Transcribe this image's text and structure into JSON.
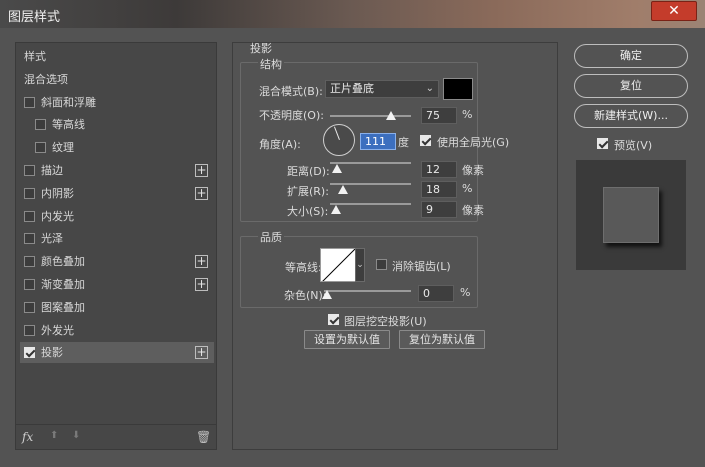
{
  "window": {
    "title": "图层样式",
    "close_label": "✕"
  },
  "left_panel": {
    "items": [
      {
        "label": "样式",
        "checkbox": false,
        "checked": false,
        "plus": false,
        "indent": 0
      },
      {
        "label": "混合选项",
        "checkbox": false,
        "checked": false,
        "plus": false,
        "indent": 0
      },
      {
        "label": "斜面和浮雕",
        "checkbox": true,
        "checked": false,
        "plus": false,
        "indent": 0
      },
      {
        "label": "等高线",
        "checkbox": true,
        "checked": false,
        "plus": false,
        "indent": 1
      },
      {
        "label": "纹理",
        "checkbox": true,
        "checked": false,
        "plus": false,
        "indent": 1
      },
      {
        "label": "描边",
        "checkbox": true,
        "checked": false,
        "plus": true,
        "indent": 0
      },
      {
        "label": "内阴影",
        "checkbox": true,
        "checked": false,
        "plus": true,
        "indent": 0
      },
      {
        "label": "内发光",
        "checkbox": true,
        "checked": false,
        "plus": false,
        "indent": 0
      },
      {
        "label": "光泽",
        "checkbox": true,
        "checked": false,
        "plus": false,
        "indent": 0
      },
      {
        "label": "颜色叠加",
        "checkbox": true,
        "checked": false,
        "plus": true,
        "indent": 0
      },
      {
        "label": "渐变叠加",
        "checkbox": true,
        "checked": false,
        "plus": true,
        "indent": 0
      },
      {
        "label": "图案叠加",
        "checkbox": true,
        "checked": false,
        "plus": false,
        "indent": 0
      },
      {
        "label": "外发光",
        "checkbox": true,
        "checked": false,
        "plus": false,
        "indent": 0
      },
      {
        "label": "投影",
        "checkbox": true,
        "checked": true,
        "plus": true,
        "indent": 0
      }
    ],
    "footer": {
      "fx": "fx",
      "up_arrow": "⬆",
      "down_arrow": "⬇",
      "trash": "🗑"
    }
  },
  "drop_shadow": {
    "section_title": "投影",
    "structure_title": "结构",
    "blend_mode_label": "混合模式(B):",
    "blend_mode_value": "正片叠底",
    "shadow_color": "#000000",
    "opacity_label": "不透明度(O):",
    "opacity_value": "75",
    "opacity_unit": "%",
    "opacity_fraction": 0.75,
    "angle_label": "角度(A):",
    "angle_value": "111",
    "angle_unit": "度",
    "global_light_label": "使用全局光(G)",
    "global_light_checked": true,
    "distance_label": "距离(D):",
    "distance_value": "12",
    "distance_unit": "像素",
    "spread_label": "扩展(R):",
    "spread_value": "18",
    "spread_unit": "%",
    "size_label": "大小(S):",
    "size_value": "9",
    "size_unit": "像素",
    "quality_title": "品质",
    "contour_label": "等高线:",
    "antialias_label": "消除锯齿(L)",
    "antialias_checked": false,
    "noise_label": "杂色(N):",
    "noise_value": "0",
    "noise_unit": "%",
    "knockout_label": "图层挖空投影(U)",
    "knockout_checked": true,
    "make_default_label": "设置为默认值",
    "reset_default_label": "复位为默认值"
  },
  "right_panel": {
    "ok_label": "确定",
    "reset_label": "复位",
    "new_style_label": "新建样式(W)...",
    "preview_label": "预览(V)",
    "preview_checked": true
  }
}
